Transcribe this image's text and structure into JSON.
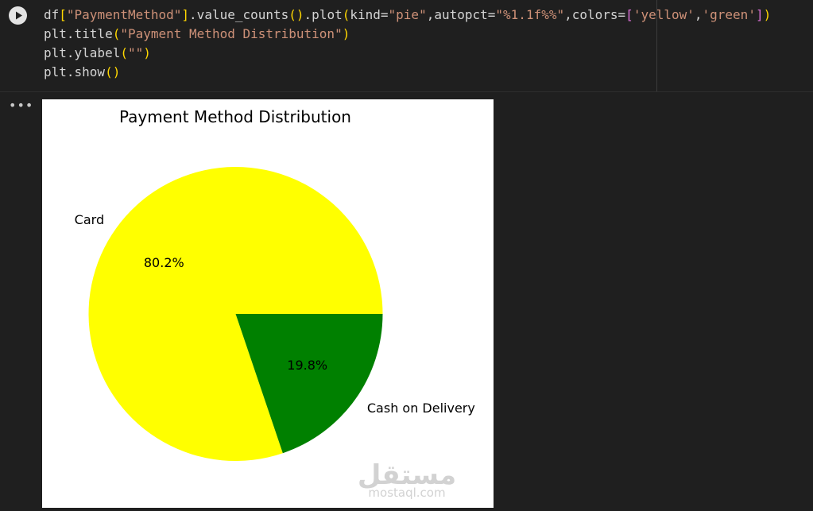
{
  "cell": {
    "run_button_icon": "play-icon",
    "code_lines": [
      [
        {
          "t": "df",
          "c": "plain"
        },
        {
          "t": "[",
          "c": "paren"
        },
        {
          "t": "\"PaymentMethod\"",
          "c": "str"
        },
        {
          "t": "]",
          "c": "paren"
        },
        {
          "t": ".value_counts",
          "c": "plain"
        },
        {
          "t": "()",
          "c": "paren"
        },
        {
          "t": ".plot",
          "c": "plain"
        },
        {
          "t": "(",
          "c": "paren"
        },
        {
          "t": "kind=",
          "c": "plain"
        },
        {
          "t": "\"pie\"",
          "c": "str"
        },
        {
          "t": ",autopct=",
          "c": "plain"
        },
        {
          "t": "\"%1.1f%%\"",
          "c": "str"
        },
        {
          "t": ",colors=",
          "c": "plain"
        },
        {
          "t": "[",
          "c": "paren2"
        },
        {
          "t": "'yellow'",
          "c": "str"
        },
        {
          "t": ",",
          "c": "plain"
        },
        {
          "t": "'green'",
          "c": "str"
        },
        {
          "t": "]",
          "c": "paren2"
        },
        {
          "t": ")",
          "c": "paren"
        }
      ],
      [
        {
          "t": "plt.title",
          "c": "plain"
        },
        {
          "t": "(",
          "c": "paren"
        },
        {
          "t": "\"Payment Method Distribution\"",
          "c": "str"
        },
        {
          "t": ")",
          "c": "paren"
        }
      ],
      [
        {
          "t": "plt.ylabel",
          "c": "plain"
        },
        {
          "t": "(",
          "c": "paren"
        },
        {
          "t": "\"\"",
          "c": "str"
        },
        {
          "t": ")",
          "c": "paren"
        }
      ],
      [
        {
          "t": "plt.show",
          "c": "plain"
        },
        {
          "t": "()",
          "c": "paren"
        }
      ]
    ]
  },
  "output": {
    "menu_label": "•••",
    "menu_icon": "more-horizontal-icon"
  },
  "chart_data": {
    "type": "pie",
    "title": "Payment Method Distribution",
    "categories": [
      "Card",
      "Cash on Delivery"
    ],
    "values": [
      80.2,
      19.8
    ],
    "labels": [
      "80.2%",
      "19.8%"
    ],
    "colors": [
      "#ffff00",
      "#008000"
    ],
    "start_angle_deg": 0,
    "legend": "none"
  },
  "watermark": {
    "arabic": "مستقل",
    "latin": "mostaql.com"
  }
}
